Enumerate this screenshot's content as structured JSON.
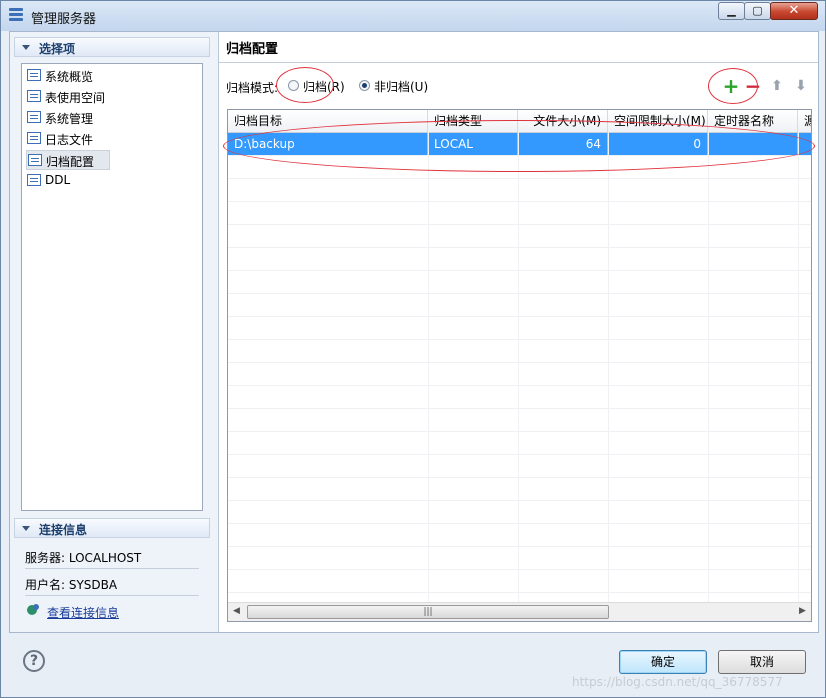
{
  "window": {
    "title": "管理服务器"
  },
  "left": {
    "select_header": "选择项",
    "tree": [
      {
        "label": "系统概览"
      },
      {
        "label": "表使用空间"
      },
      {
        "label": "系统管理"
      },
      {
        "label": "日志文件"
      },
      {
        "label": "归档配置",
        "selected": true
      },
      {
        "label": "DDL"
      }
    ],
    "conn_header": "连接信息",
    "server": "服务器: LOCALHOST",
    "user": "用户名: SYSDBA",
    "view_link": "查看连接信息"
  },
  "right": {
    "title": "归档配置",
    "mode_label": "归档模式:",
    "radio_archive": "归档(R)",
    "radio_noarchive": "非归档(U)",
    "selected_mode": "非归档(U)",
    "toolbar": {
      "add": "+",
      "remove": "−",
      "up": "⬆",
      "down": "⬇"
    },
    "table": {
      "columns": [
        "归档目标",
        "归档类型",
        "文件大小(M)",
        "空间限制大小(M)",
        "定时器名称",
        "源"
      ],
      "rows": [
        [
          "D:\\backup",
          "LOCAL",
          "64",
          "0",
          "",
          ""
        ]
      ],
      "scroll_grip": "|||"
    }
  },
  "footer": {
    "help": "?",
    "ok": "确定",
    "cancel": "取消"
  },
  "watermark": "https://blog.csdn.net/qq_36778577",
  "colors": {
    "selection": "#3399ff",
    "annotation": "#e0323c",
    "add": "#2aa52a",
    "remove": "#d0273a"
  }
}
